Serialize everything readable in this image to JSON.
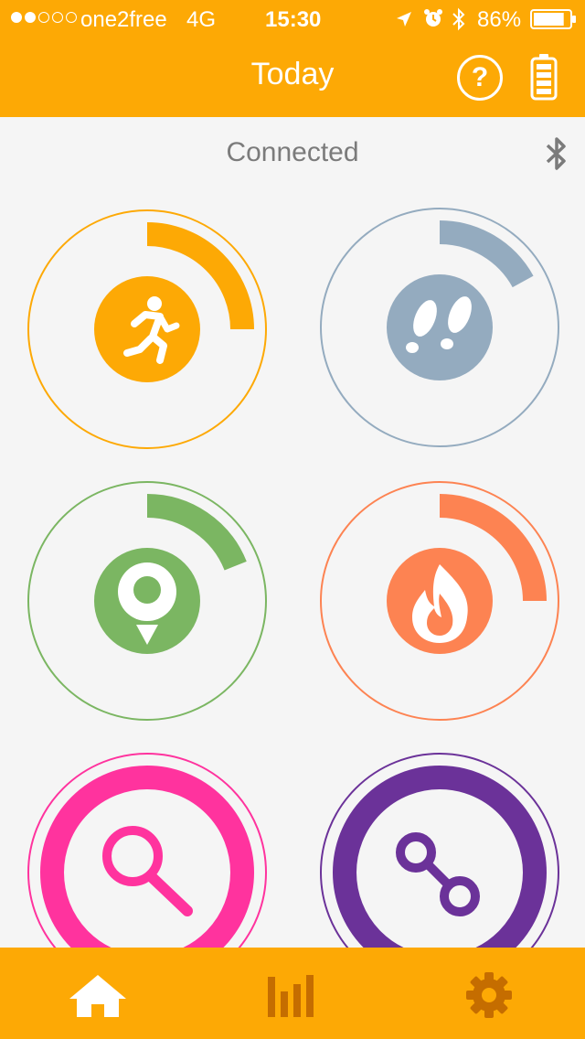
{
  "status_bar": {
    "signal_dots": [
      true,
      true,
      false,
      false,
      false
    ],
    "carrier": "one2free",
    "network": "4G",
    "time": "15:30",
    "battery_percent": "86%",
    "battery_level": 0.86
  },
  "nav": {
    "title": "Today",
    "help_label": "?"
  },
  "main": {
    "connection_status": "Connected"
  },
  "tiles": [
    {
      "id": "activity",
      "icon": "running-icon",
      "color": "#fda905",
      "progress": 0.25
    },
    {
      "id": "steps",
      "icon": "footprints-icon",
      "color": "#94abbf",
      "progress": 0.17
    },
    {
      "id": "distance",
      "icon": "location-pin-icon",
      "color": "#7bb662",
      "progress": 0.19
    },
    {
      "id": "calories",
      "icon": "flame-icon",
      "color": "#fd8352",
      "progress": 0.25
    },
    {
      "id": "find",
      "icon": "search-icon",
      "color": "#ff339e",
      "progress": 1
    },
    {
      "id": "link",
      "icon": "link-icon",
      "color": "#6b3299",
      "progress": 1
    }
  ],
  "tabs": [
    {
      "id": "home",
      "icon": "home-icon",
      "active": true
    },
    {
      "id": "stats",
      "icon": "bar-chart-icon",
      "active": false
    },
    {
      "id": "settings",
      "icon": "gear-icon",
      "active": false
    }
  ],
  "colors": {
    "accent": "#fda905",
    "tab_active": "#ffffff",
    "tab_inactive": "#c56d00",
    "background": "#f5f5f5",
    "muted_text": "#7b7b7b"
  }
}
